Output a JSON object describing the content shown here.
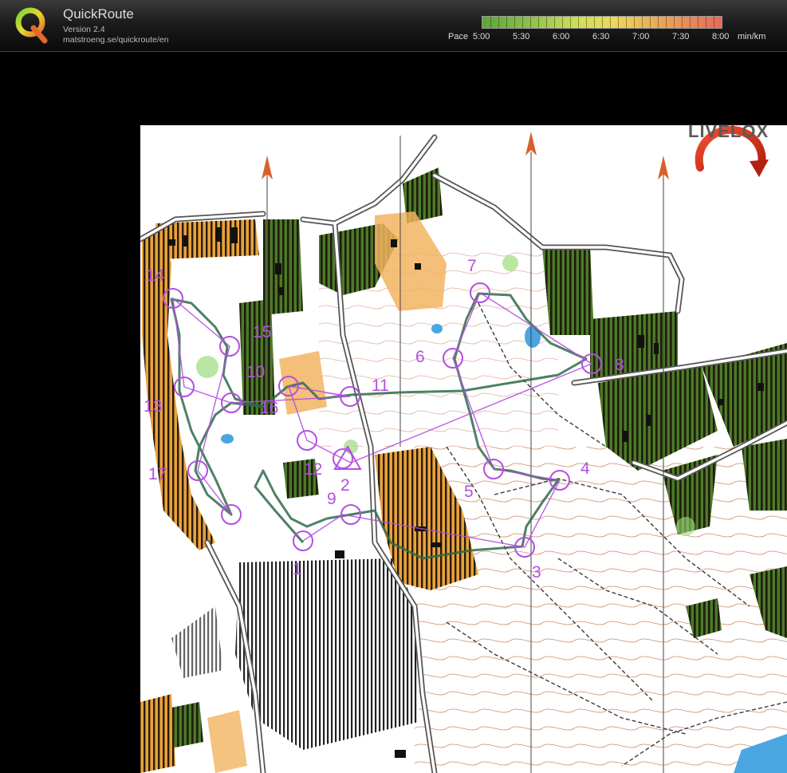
{
  "app": {
    "title": "QuickRoute",
    "version": "Version 2.4",
    "url": "matstroeng.se/quickroute/en"
  },
  "pace_legend": {
    "prefix": "Pace",
    "labels": [
      "5:00",
      "5:30",
      "6:00",
      "6:30",
      "7:00",
      "7:30",
      "8:00"
    ],
    "unit": "min/km",
    "colors": [
      "#5fa637",
      "#8fc04a",
      "#cfe05a",
      "#ecd85a",
      "#eba657",
      "#e56a5b"
    ]
  },
  "watermark": {
    "text": "LIVELOX"
  },
  "course": {
    "color": "#b44fe0",
    "controls": [
      "1",
      "2",
      "3",
      "4",
      "5",
      "6",
      "7",
      "8",
      "9",
      "10",
      "11",
      "12",
      "13",
      "14",
      "15",
      "16",
      "17"
    ]
  },
  "route": {
    "color": "#2e6b4a"
  }
}
